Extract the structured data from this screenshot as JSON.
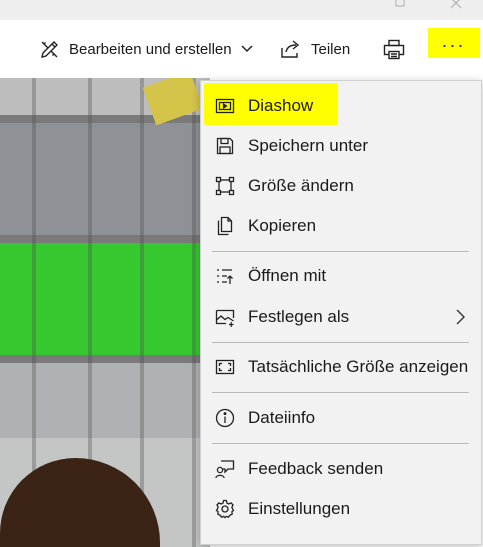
{
  "toolbar": {
    "edit_label": "Bearbeiten und erstellen",
    "share_label": "Teilen",
    "more_label": "..."
  },
  "menu": {
    "items": [
      {
        "label": "Diashow",
        "icon": "slideshow-icon"
      },
      {
        "label": "Speichern unter",
        "icon": "save-icon"
      },
      {
        "label": "Größe ändern",
        "icon": "resize-icon"
      },
      {
        "label": "Kopieren",
        "icon": "copy-icon"
      },
      {
        "label": "Öffnen mit",
        "icon": "open-with-icon"
      },
      {
        "label": "Festlegen als",
        "icon": "set-as-icon"
      },
      {
        "label": "Tatsächliche Größe anzeigen",
        "icon": "actual-size-icon"
      },
      {
        "label": "Dateiinfo",
        "icon": "info-icon"
      },
      {
        "label": "Feedback senden",
        "icon": "feedback-icon"
      },
      {
        "label": "Einstellungen",
        "icon": "settings-icon"
      }
    ]
  },
  "colors": {
    "highlight": "#ffff00",
    "menu_background": "#f2f2f2",
    "separator": "#b8b8b8"
  }
}
